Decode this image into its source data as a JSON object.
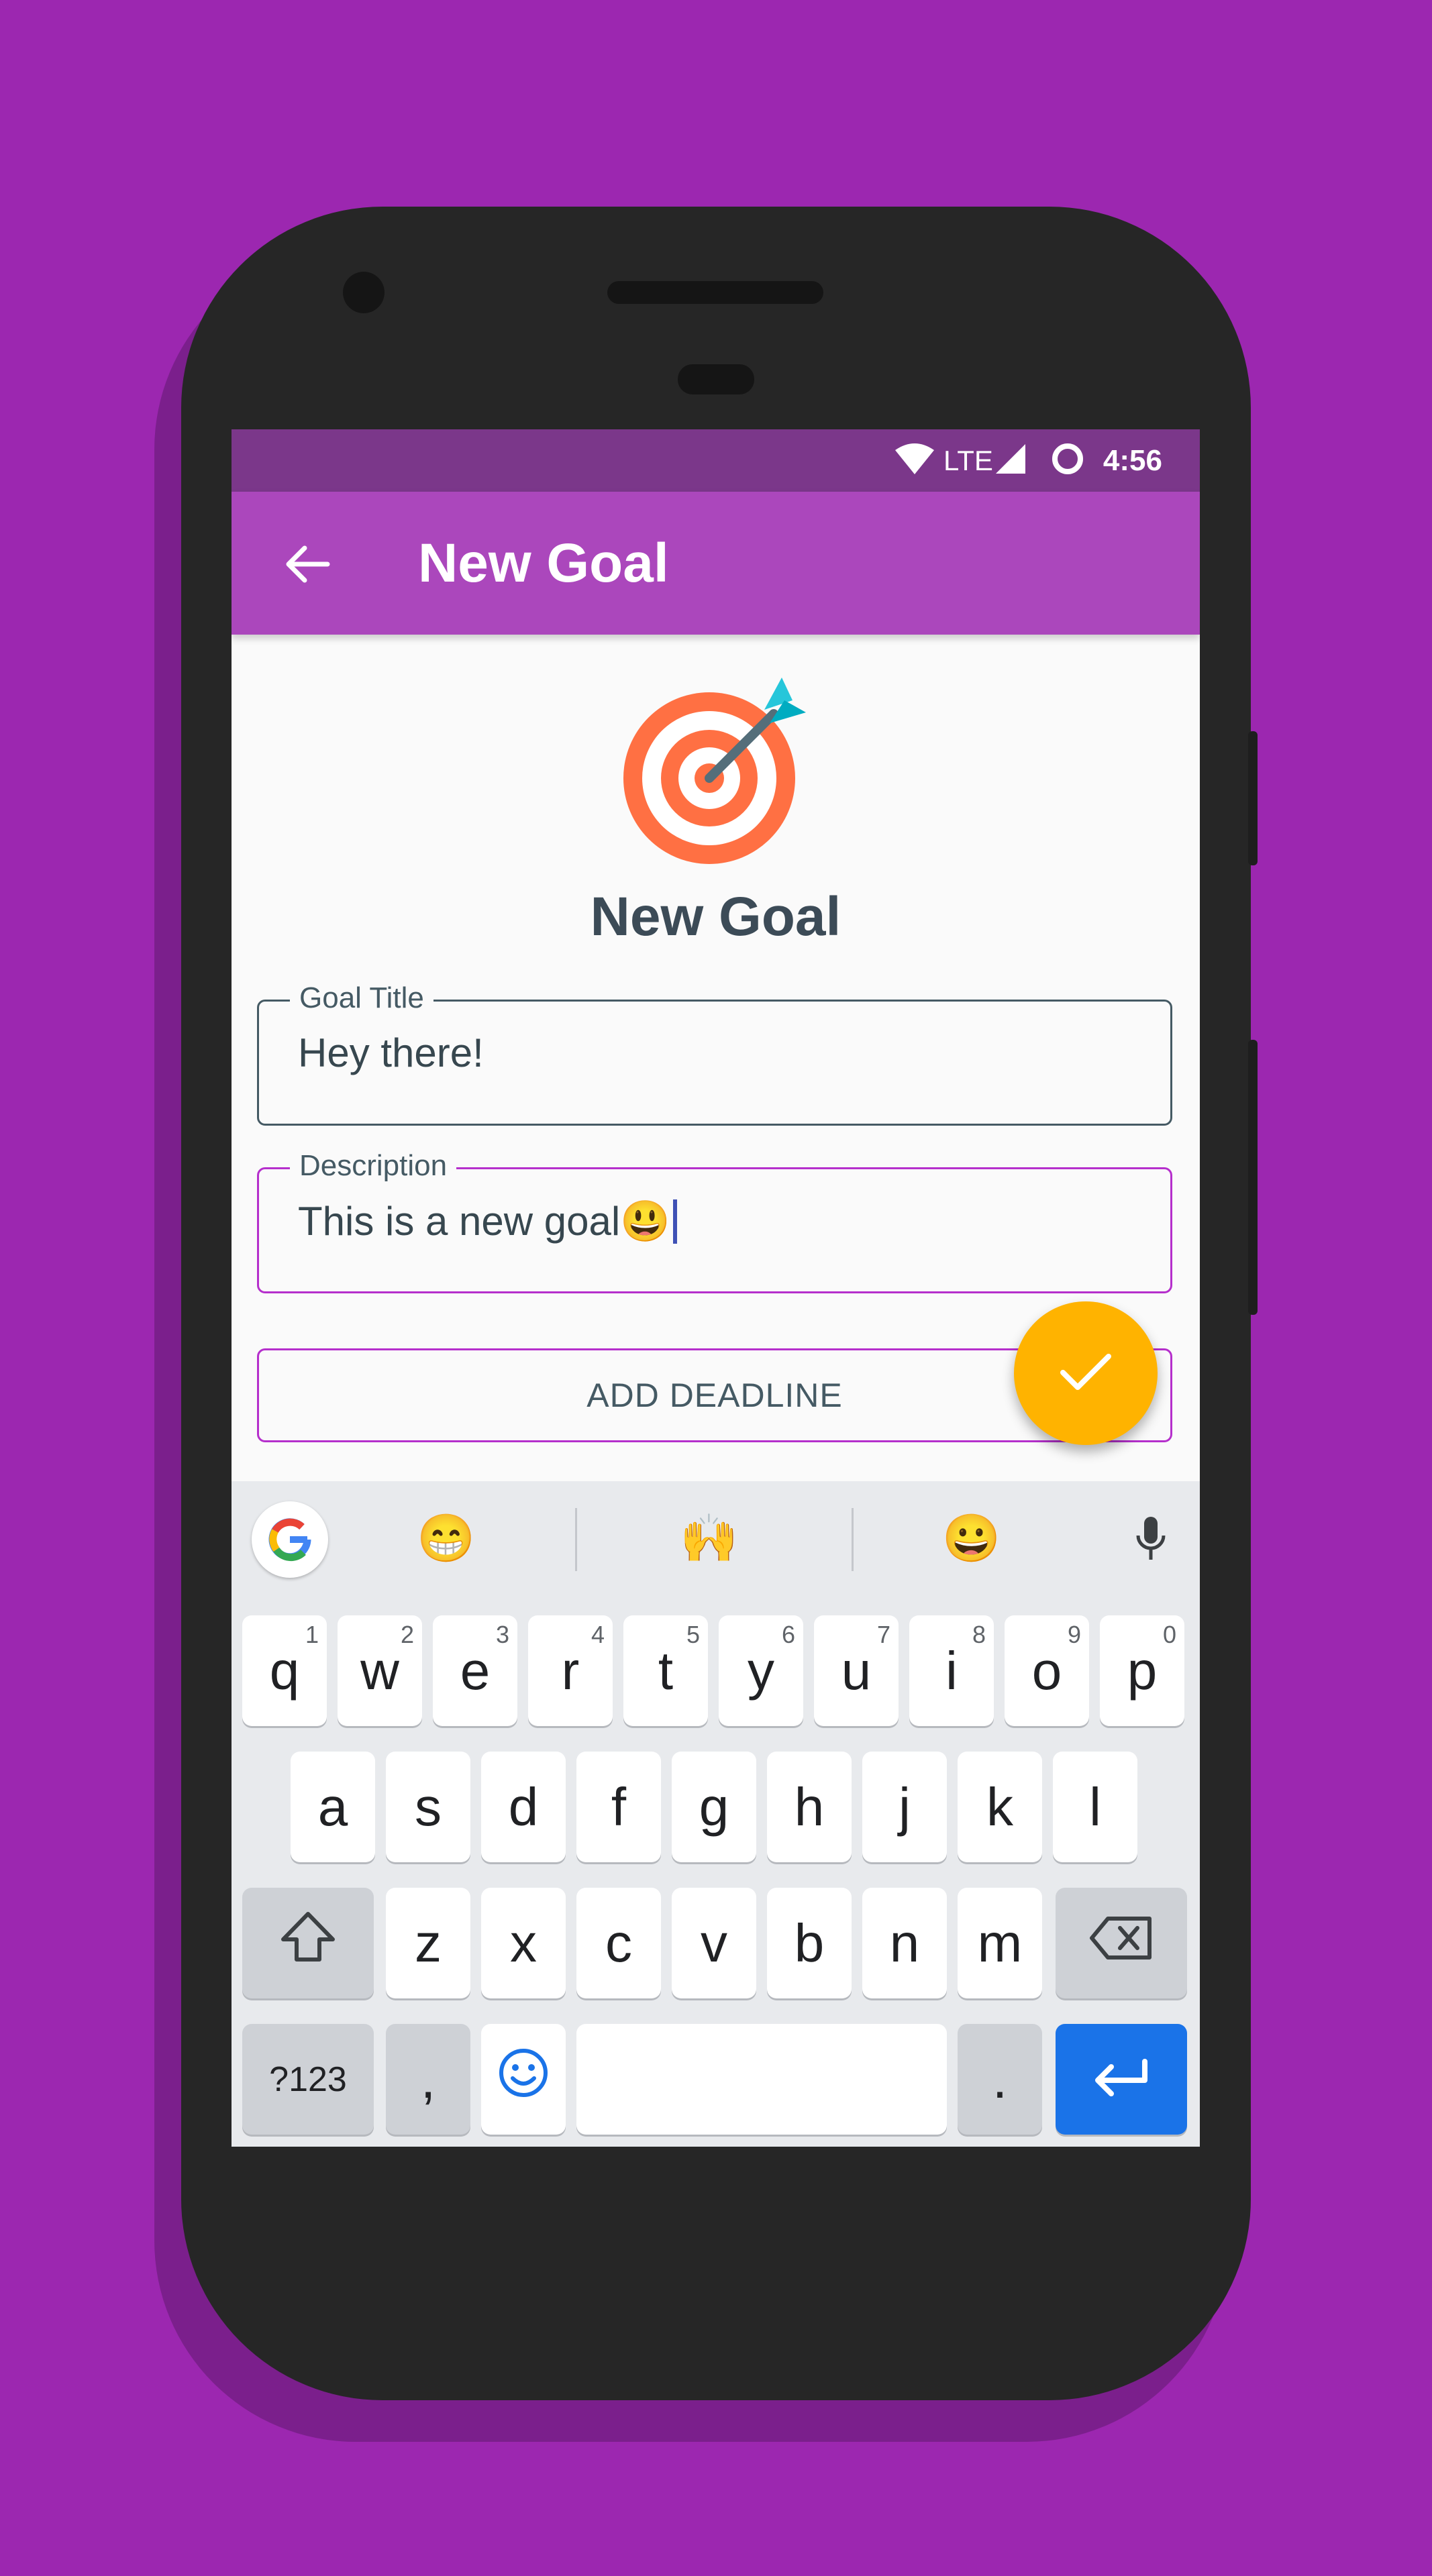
{
  "colors": {
    "background": "#9c27b0",
    "status_bar": "#7b378a",
    "app_bar": "#ab47bc",
    "accent": "#ffb300",
    "focused_border": "#b52fcc",
    "enter_key": "#1a73e8"
  },
  "status_bar": {
    "network": "LTE",
    "time": "4:56",
    "icons": [
      "wifi-icon",
      "signal-icon",
      "circle-icon"
    ]
  },
  "app_bar": {
    "title": "New Goal",
    "back_icon": "arrow-back-icon"
  },
  "content": {
    "illustration": "target-dart-icon",
    "heading": "New Goal",
    "goal_title": {
      "label": "Goal Title",
      "value": "Hey there!"
    },
    "description": {
      "label": "Description",
      "value": "This is a new goal😃"
    },
    "add_deadline_label": "ADD DEADLINE",
    "fab_icon": "check-icon"
  },
  "keyboard": {
    "suggestions": [
      "😁",
      "🙌",
      "😀"
    ],
    "suggestion_icons": [
      "google-icon",
      "mic-icon"
    ],
    "row1": [
      {
        "key": "q",
        "hint": "1"
      },
      {
        "key": "w",
        "hint": "2"
      },
      {
        "key": "e",
        "hint": "3"
      },
      {
        "key": "r",
        "hint": "4"
      },
      {
        "key": "t",
        "hint": "5"
      },
      {
        "key": "y",
        "hint": "6"
      },
      {
        "key": "u",
        "hint": "7"
      },
      {
        "key": "i",
        "hint": "8"
      },
      {
        "key": "o",
        "hint": "9"
      },
      {
        "key": "p",
        "hint": "0"
      }
    ],
    "row2": [
      "a",
      "s",
      "d",
      "f",
      "g",
      "h",
      "j",
      "k",
      "l"
    ],
    "row3": [
      "z",
      "x",
      "c",
      "v",
      "b",
      "n",
      "m"
    ],
    "symbols_label": "?123",
    "comma": ",",
    "period": ".",
    "special_icons": [
      "shift-icon",
      "backspace-icon",
      "emoji-icon",
      "enter-icon"
    ]
  }
}
